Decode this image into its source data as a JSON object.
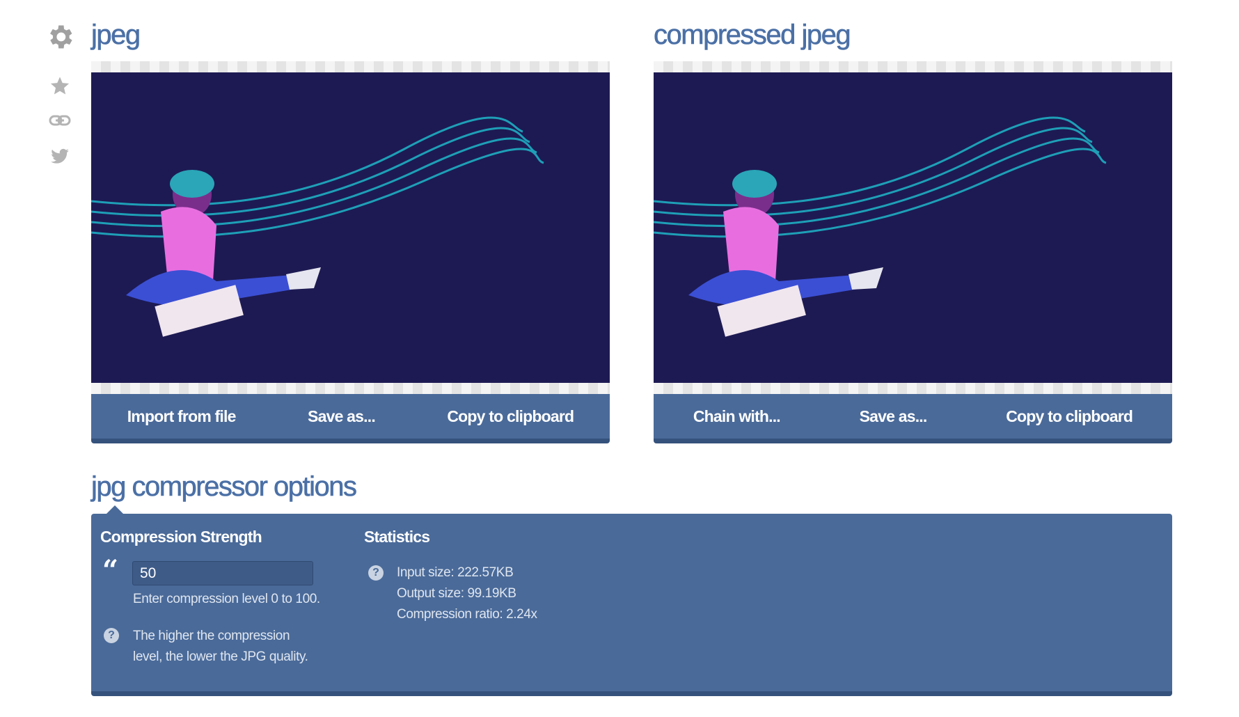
{
  "sidebar": {
    "icons": [
      "gear-icon",
      "star-icon",
      "link-icon",
      "twitter-icon"
    ]
  },
  "left_panel": {
    "title": "jpeg",
    "buttons": [
      "Import from file",
      "Save as...",
      "Copy to clipboard"
    ]
  },
  "right_panel": {
    "title": "compressed jpeg",
    "buttons": [
      "Chain with...",
      "Save as...",
      "Copy to clipboard"
    ]
  },
  "options": {
    "title": "jpg compressor options",
    "compression": {
      "heading": "Compression Strength",
      "value": "50",
      "hint": "Enter compression level 0 to 100.",
      "help_line1": "The higher the compression",
      "help_line2": "level, the lower the JPG quality."
    },
    "statistics": {
      "heading": "Statistics",
      "input_size": "Input size: 222.57KB",
      "output_size": "Output size: 99.19KB",
      "ratio": "Compression ratio: 2.24x"
    }
  },
  "colors": {
    "accent": "#4b70a6",
    "panel": "#4a6a99",
    "image_bg": "#1d1a53"
  }
}
